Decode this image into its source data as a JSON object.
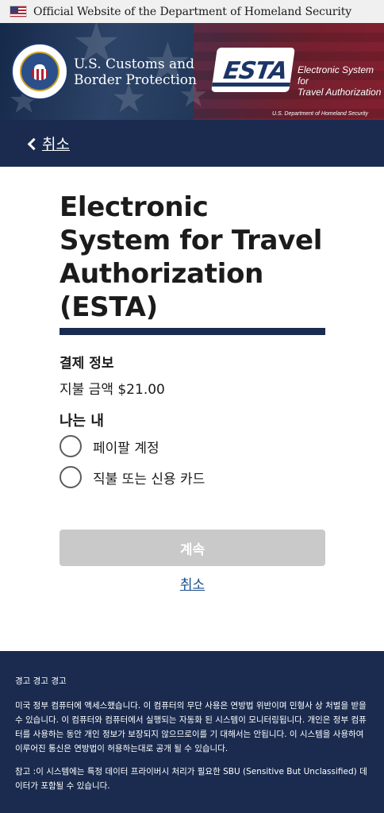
{
  "gov_banner": {
    "text": "Official Website of the Department of Homeland Security",
    "flag_icon": "us-flag-icon"
  },
  "header": {
    "agency_line1": "U.S. Customs and",
    "agency_line2": "Border Protection",
    "esta_logo_word": "ESTA",
    "esta_sub_line1": "Electronic System for",
    "esta_sub_line2": "Travel Authorization",
    "esta_dept": "U.S. Department of Homeland Security",
    "seal_icon": "dhs-seal-icon"
  },
  "nav": {
    "back_label": "취소",
    "back_icon": "chevron-left-icon"
  },
  "main": {
    "title": "Electronic System for Travel Authorization (ESTA)",
    "section_label": "결제 정보",
    "amount_label": "지불 금액 $21.00",
    "question": "나는 내",
    "options": [
      {
        "label": "페이팔 계정",
        "selected": false
      },
      {
        "label": "직불 또는 신용 카드",
        "selected": false
      }
    ],
    "continue_label": "계속",
    "cancel_label": "취소"
  },
  "footer": {
    "warning_title": "경고 경고 경고",
    "warning_text": "미국 정부 컴퓨터에 액세스했습니다. 이 컴퓨터의 무단 사용은 연방법 위반이며 민형사 상 처벌을 받을 수 있습니다. 이 컴퓨터와 컴퓨터에서 실행되는 자동화 된 시스템이 모니터링됩니다. 개인은 정부 컴퓨터를 사용하는 동안 개인 정보가 보장되지 않으므로이를 기 대해서는 안됩니다. 이 시스템을 사용하여 이루어진 통신은 연방법이 허용하는대로 공개 될 수 있습니다.",
    "note_text": "참고 :이 시스템에는 특정 데이터 프라이버시 처리가 필요한 SBU (Sensitive But Unclassified) 데이터가 포함될 수 있습니다."
  },
  "colors": {
    "navy": "#1a2b4f",
    "link_blue": "#1a4e8a",
    "disabled_button": "#c9c9c9"
  }
}
